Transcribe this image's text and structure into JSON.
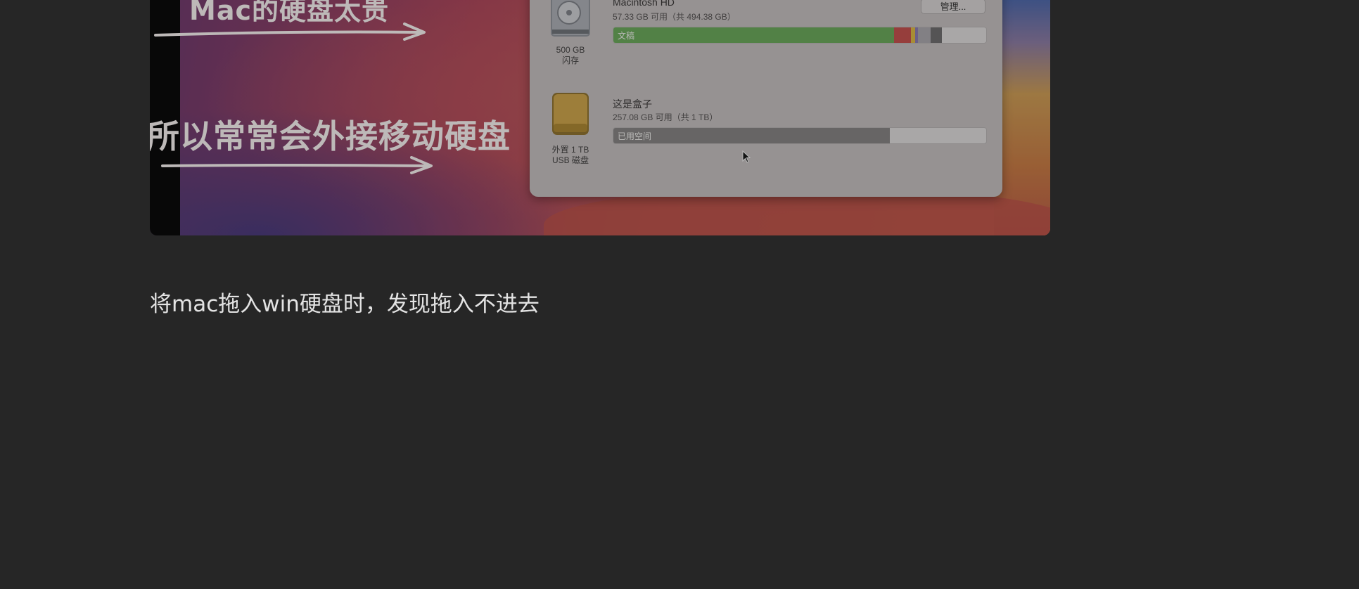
{
  "image": {
    "line1": "Mac的硬盘太贵",
    "line2": "所以常常会外接移动硬盘"
  },
  "storage": {
    "manage_button": "管理...",
    "disks": [
      {
        "name": "Macintosh HD",
        "free": "57.33 GB 可用（共 494.38 GB）",
        "capacity_line1": "500 GB",
        "capacity_line2": "闪存",
        "bar_label": "文稿",
        "icon": "internal-drive-icon"
      },
      {
        "name": "这是盒子",
        "free": "257.08 GB 可用（共 1 TB）",
        "capacity_line1": "外置 1 TB",
        "capacity_line2": "USB 磁盘",
        "bar_label": "已用空间",
        "icon": "external-drive-icon"
      }
    ]
  },
  "caption": "将mac拖入win硬盘时，发现拖入不进去"
}
